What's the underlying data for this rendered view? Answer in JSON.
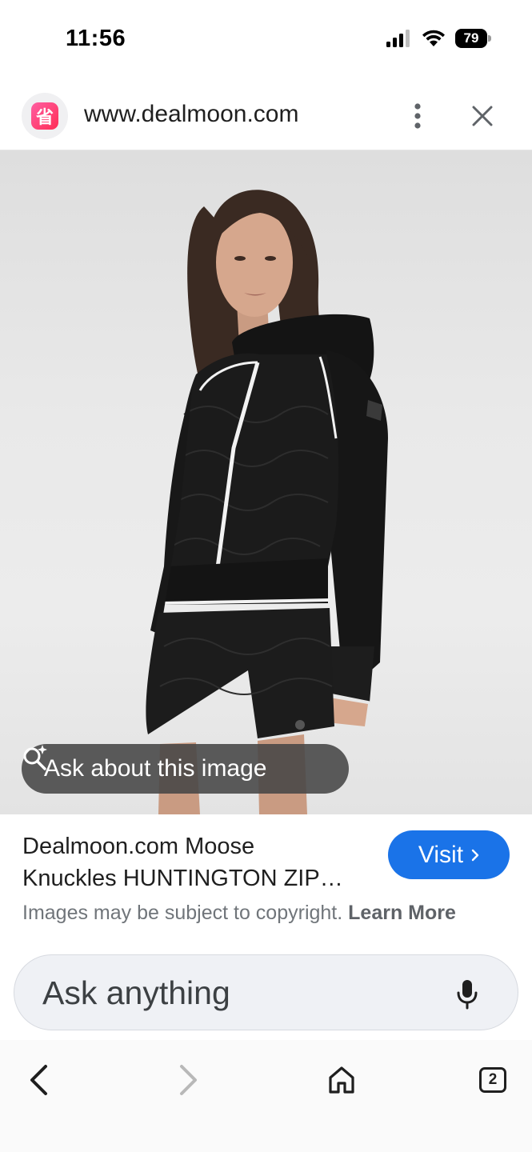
{
  "status_bar": {
    "time": "11:56",
    "battery": "79"
  },
  "browser": {
    "url": "www.dealmoon.com"
  },
  "image_overlay": {
    "ask_label": "Ask about this image"
  },
  "result": {
    "title_line1": "Dealmoon.com Moose",
    "title_line2": "Knuckles HUNTINGTON ZIP…",
    "visit_label": "Visit",
    "copyright_text": "Images may be subject to copyright.",
    "learn_more": "Learn More"
  },
  "search": {
    "placeholder": "Ask anything"
  },
  "nav": {
    "tab_count": "2"
  }
}
